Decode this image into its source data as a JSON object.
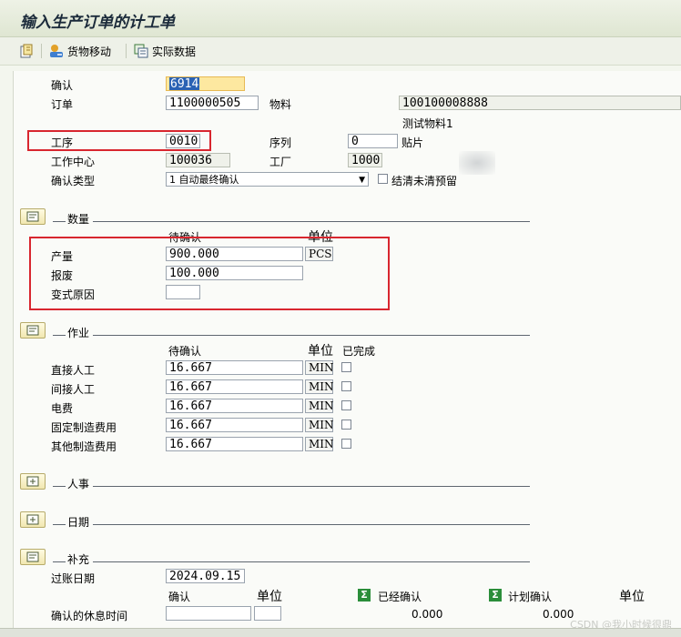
{
  "title": "输入生产订单的计工单",
  "toolbar": {
    "goods_movement": "货物移动",
    "actual_data": "实际数据"
  },
  "header": {
    "confirm_label": "确认",
    "confirm_value": "6914",
    "order_label": "订单",
    "order_value": "1100000505",
    "material_label": "物料",
    "material_value": "100100008888",
    "material_desc": "测试物料1",
    "operation_label": "工序",
    "operation_value": "0010",
    "sequence_label": "序列",
    "sequence_value": "0",
    "sequence_text": "贴片",
    "workcenter_label": "工作中心",
    "workcenter_value": "100036",
    "plant_label": "工厂",
    "plant_value": "1000",
    "conftype_label": "确认类型",
    "conftype_value": "1 自动最终确认",
    "clear_reservation_label": "结清未清预留"
  },
  "quantity": {
    "title": "数量",
    "col_pending": "待确认",
    "col_unit": "单位",
    "rows": [
      {
        "label": "产量",
        "value": "900.000",
        "unit": "PCS"
      },
      {
        "label": "报废",
        "value": "100.000"
      },
      {
        "label": "变式原因",
        "value": ""
      }
    ]
  },
  "activity": {
    "title": "作业",
    "col_pending": "待确认",
    "col_unit": "单位",
    "col_done": "已完成",
    "rows": [
      {
        "label": "直接人工",
        "value": "16.667",
        "unit": "MIN"
      },
      {
        "label": "间接人工",
        "value": "16.667",
        "unit": "MIN"
      },
      {
        "label": "电费",
        "value": "16.667",
        "unit": "MIN"
      },
      {
        "label": "固定制造费用",
        "value": "16.667",
        "unit": "MIN"
      },
      {
        "label": "其他制造费用",
        "value": "16.667",
        "unit": "MIN"
      }
    ]
  },
  "personnel": {
    "title": "人事"
  },
  "dates": {
    "title": "日期"
  },
  "supplement": {
    "title": "补充",
    "posting_date_label": "过账日期",
    "posting_date_value": "2024.09.15",
    "col_confirm": "确认",
    "col_unit": "单位",
    "col_confirmed": "已经确认",
    "col_planned": "计划确认",
    "col_unit2": "单位",
    "break_label": "确认的休息时间",
    "confirmed_value": "0.000",
    "planned_value": "0.000"
  },
  "watermark": "CSDN @我小时候很鼎",
  "colors": {
    "red_highlight": "#d8262f",
    "field_highlight": "#fde8a0",
    "selection": "#2a62b4",
    "sigma_green": "#2b8e3a"
  }
}
